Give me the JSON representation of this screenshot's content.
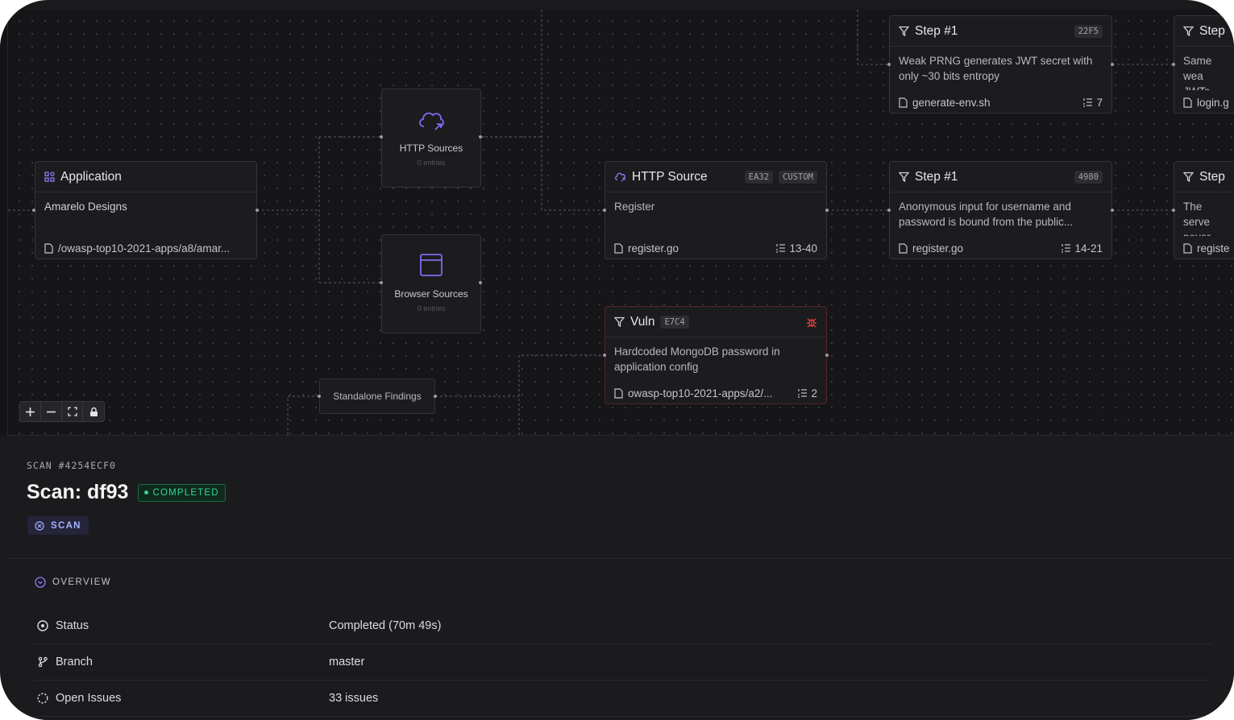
{
  "nodes": {
    "application": {
      "title": "Application",
      "desc": "Amarelo Designs",
      "file": "/owasp-top10-2021-apps/a8/amar..."
    },
    "http_sources": {
      "label": "HTTP Sources",
      "count": "0 entries"
    },
    "browser_sources": {
      "label": "Browser Sources",
      "count": "0 entries"
    },
    "http_source": {
      "title": "HTTP Source",
      "tag": "EA32",
      "tag2": "CUSTOM",
      "desc": "Register",
      "file": "register.go",
      "lines": "13-40"
    },
    "step_top": {
      "title": "Step #1",
      "tag": "22F5",
      "desc": "Weak PRNG generates JWT secret with only ~30 bits entropy",
      "file": "generate-env.sh",
      "lines": "7"
    },
    "step_mid": {
      "title": "Step #1",
      "tag": "4980",
      "desc": "Anonymous input for username and password is bound from the public...",
      "file": "register.go",
      "lines": "14-21"
    },
    "step_right_top": {
      "title": "Step",
      "desc": "Same wea JWTs",
      "file": "login.g"
    },
    "step_right_mid": {
      "title": "Step",
      "desc": "The serve never reje",
      "file": "registe"
    },
    "vuln": {
      "title": "Vuln",
      "tag": "E7C4",
      "desc": "Hardcoded MongoDB password in application config",
      "file": "owasp-top10-2021-apps/a2/...",
      "lines": "2"
    },
    "standalone": {
      "label": "Standalone Findings"
    }
  },
  "zoom_controls": [
    "zoom-in",
    "zoom-out",
    "fit-view",
    "lock"
  ],
  "panel": {
    "scan_id": "SCAN #4254ECF0",
    "title": "Scan: df93",
    "status": "COMPLETED",
    "chip": "SCAN",
    "overview_label": "OVERVIEW",
    "rows": [
      {
        "key": "Status",
        "value": "Completed (70m 49s)"
      },
      {
        "key": "Branch",
        "value": "master"
      },
      {
        "key": "Open Issues",
        "value": "33 issues"
      }
    ]
  },
  "colors": {
    "accent": "#8b7cf6",
    "success": "#34d399",
    "danger": "#ef4444"
  }
}
